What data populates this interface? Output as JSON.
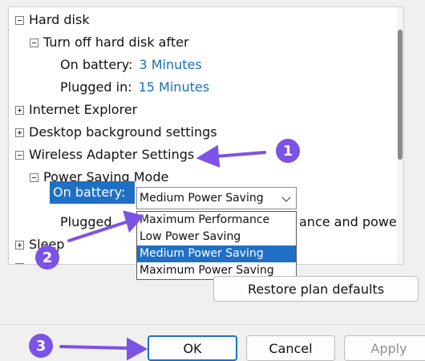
{
  "tree": {
    "hard_disk": "Hard disk",
    "turn_off_hard_disk": "Turn off hard disk after",
    "hd_on_battery_label": "On battery:",
    "hd_on_battery_value": "3 Minutes",
    "hd_plugged_in_label": "Plugged in:",
    "hd_plugged_in_value": "15 Minutes",
    "internet_explorer": "Internet Explorer",
    "desktop_background": "Desktop background settings",
    "wireless_adapter": "Wireless Adapter Settings",
    "power_saving_mode": "Power Saving Mode",
    "wa_on_battery_label": "On battery:",
    "wa_plugged_label": "Plugged",
    "wa_plugged_value_partial": "ance and power sav",
    "sleep": "Sleep"
  },
  "combo": {
    "selected": "Medium Power Saving",
    "options": [
      "Maximum Performance",
      "Low Power Saving",
      "Medium Power Saving",
      "Maximum Power Saving"
    ],
    "highlighted_index": 2
  },
  "buttons": {
    "restore_defaults": "Restore plan defaults",
    "ok": "OK",
    "cancel": "Cancel",
    "apply": "Apply"
  },
  "callouts": [
    "1",
    "2",
    "3"
  ],
  "colors": {
    "selection": "#1f6fc5",
    "link": "#1a6fb5",
    "callout": "#7b53e5"
  }
}
